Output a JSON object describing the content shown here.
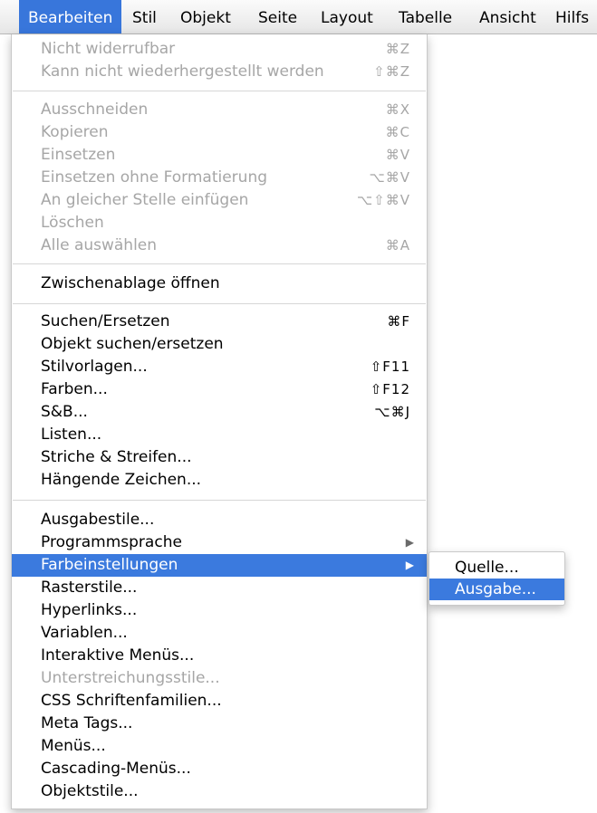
{
  "menubar": {
    "items": [
      {
        "label": "Bearbeiten",
        "active": true
      },
      {
        "label": "Stil"
      },
      {
        "label": "Objekt"
      },
      {
        "label": "Seite"
      },
      {
        "label": "Layout"
      },
      {
        "label": "Tabelle"
      },
      {
        "label": "Ansicht"
      },
      {
        "label": "Hilfs"
      }
    ]
  },
  "menu": {
    "group1": [
      {
        "label": "Nicht widerrufbar",
        "shortcut": "⌘Z",
        "disabled": true
      },
      {
        "label": "Kann nicht wiederhergestellt werden",
        "shortcut": "⇧⌘Z",
        "disabled": true
      }
    ],
    "group2": [
      {
        "label": "Ausschneiden",
        "shortcut": "⌘X",
        "disabled": true
      },
      {
        "label": "Kopieren",
        "shortcut": "⌘C",
        "disabled": true
      },
      {
        "label": "Einsetzen",
        "shortcut": "⌘V",
        "disabled": true
      },
      {
        "label": "Einsetzen ohne Formatierung",
        "shortcut": "⌥⌘V",
        "disabled": true
      },
      {
        "label": "An gleicher Stelle einfügen",
        "shortcut": "⌥⇧⌘V",
        "disabled": true
      },
      {
        "label": "Löschen",
        "shortcut": "",
        "disabled": true
      },
      {
        "label": "Alle auswählen",
        "shortcut": "⌘A",
        "disabled": true
      }
    ],
    "group3": [
      {
        "label": "Zwischenablage öffnen",
        "shortcut": ""
      }
    ],
    "group4": [
      {
        "label": "Suchen/Ersetzen",
        "shortcut": "⌘F"
      },
      {
        "label": "Objekt suchen/ersetzen",
        "shortcut": ""
      },
      {
        "label": "Stilvorlagen...",
        "shortcut": "⇧F11"
      },
      {
        "label": "Farben...",
        "shortcut": "⇧F12"
      },
      {
        "label": "S&B...",
        "shortcut": "⌥⌘J"
      },
      {
        "label": "Listen...",
        "shortcut": ""
      },
      {
        "label": "Striche & Streifen...",
        "shortcut": ""
      },
      {
        "label": "Hängende Zeichen...",
        "shortcut": ""
      }
    ],
    "group5": [
      {
        "label": "Ausgabestile...",
        "shortcut": ""
      },
      {
        "label": "Programmsprache",
        "submenu_arrow": "▶"
      },
      {
        "label": "Farbeinstellungen",
        "submenu_arrow": "▶",
        "highlighted": true
      },
      {
        "label": "Rasterstile...",
        "shortcut": ""
      },
      {
        "label": "Hyperlinks...",
        "shortcut": ""
      },
      {
        "label": "Variablen...",
        "shortcut": ""
      },
      {
        "label": "Interaktive Menüs...",
        "shortcut": ""
      },
      {
        "label": "Unterstreichungsstile...",
        "shortcut": "",
        "disabled": true
      },
      {
        "label": "CSS Schriftenfamilien...",
        "shortcut": ""
      },
      {
        "label": "Meta Tags...",
        "shortcut": ""
      },
      {
        "label": "Menüs...",
        "shortcut": ""
      },
      {
        "label": "Cascading-Menüs...",
        "shortcut": ""
      },
      {
        "label": "Objektstile...",
        "shortcut": ""
      }
    ]
  },
  "submenu": {
    "items": [
      {
        "label": "Quelle..."
      },
      {
        "label": "Ausgabe...",
        "highlighted": true
      }
    ]
  },
  "colors": {
    "highlight": "#3b7ade",
    "disabled_text": "#a6a6a6",
    "text": "#000000"
  }
}
